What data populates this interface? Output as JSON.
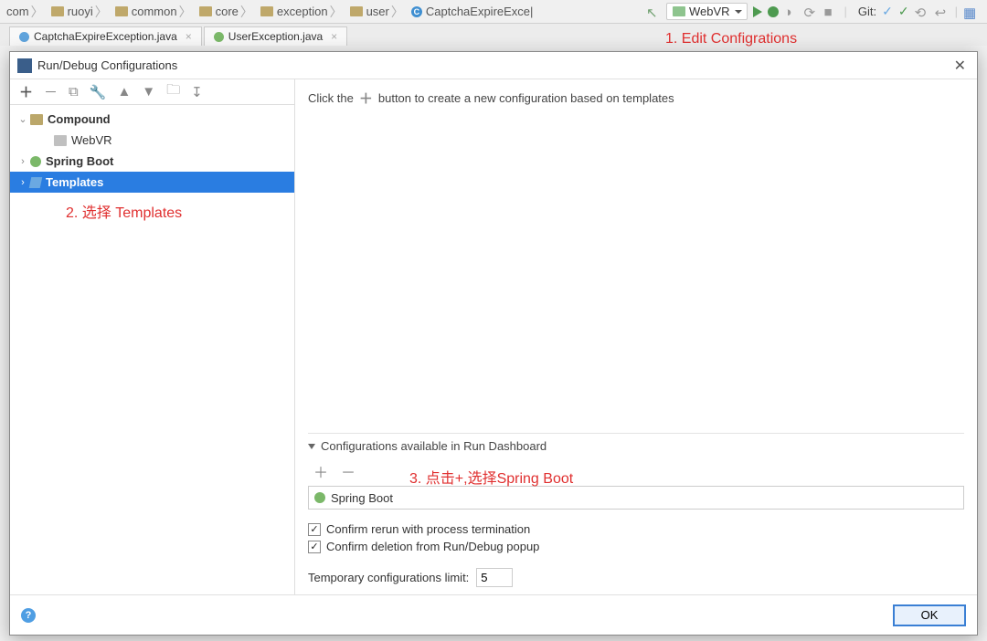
{
  "breadcrumb": [
    "com",
    "ruoyi",
    "common",
    "core",
    "exception",
    "user",
    "CaptchaExpireExce|"
  ],
  "topbar": {
    "runconfig": "WebVR",
    "git_label": "Git:"
  },
  "tabs": [
    {
      "label": "CaptchaExpireException.java"
    },
    {
      "label": "UserException.java"
    }
  ],
  "dialog": {
    "title": "Run/Debug Configurations",
    "tree": {
      "compound": "Compound",
      "compound_child": "WebVR",
      "spring": "Spring Boot",
      "templates": "Templates"
    },
    "hint_pre": "Click the",
    "hint_post": "button to create a new configuration based on templates",
    "dashboard": {
      "header": "Configurations available in Run Dashboard",
      "item": "Spring Boot"
    },
    "confirm_rerun": "Confirm rerun with process termination",
    "confirm_delete": "Confirm deletion from Run/Debug popup",
    "temp_limit_label": "Temporary configurations limit:",
    "temp_limit_value": "5",
    "ok": "OK"
  },
  "annotations": {
    "a1": "1. Edit Configrations",
    "a2": "2. 选择 Templates",
    "a3": "3. 点击+,选择Spring Boot"
  }
}
